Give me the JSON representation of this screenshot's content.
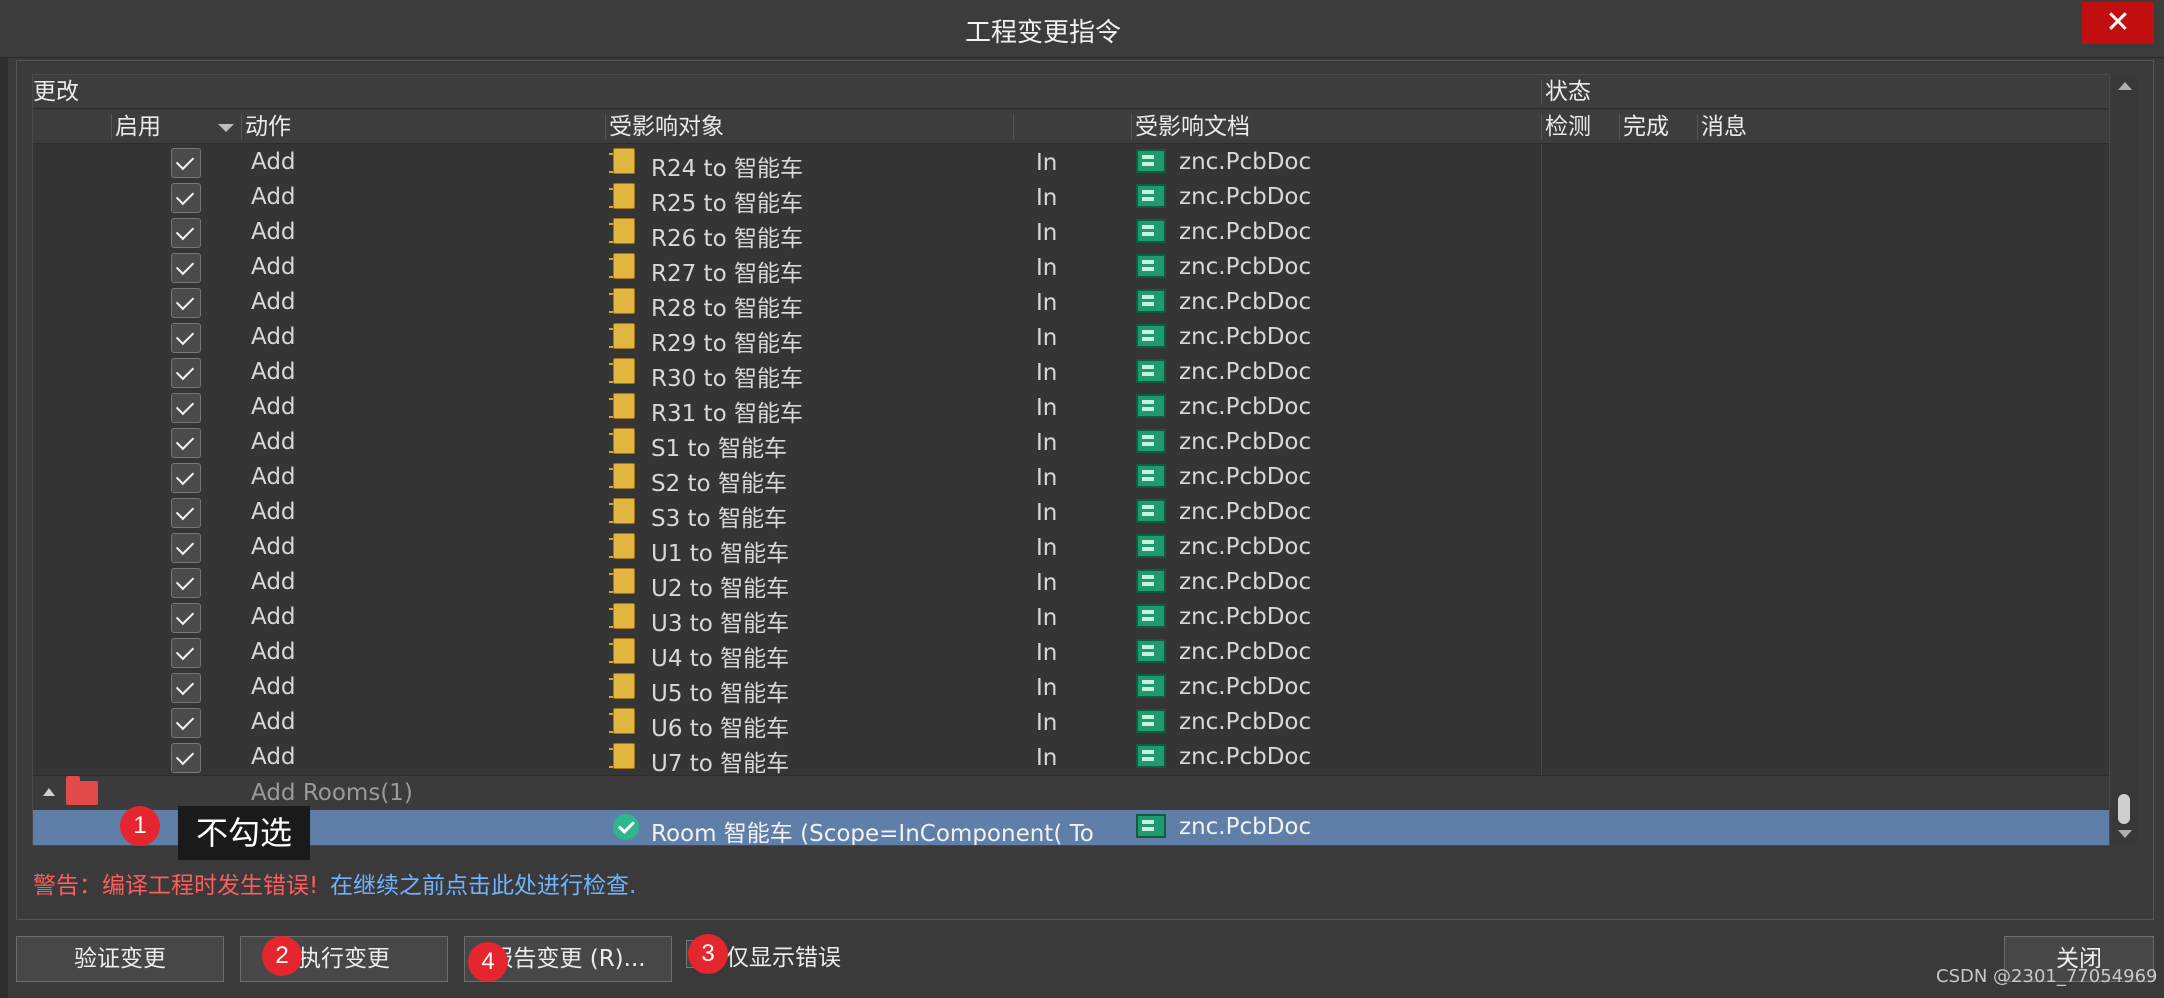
{
  "window": {
    "title": "工程变更指令",
    "close_glyph": "✕"
  },
  "table": {
    "group_headers": {
      "changes": "更改",
      "status": "状态"
    },
    "columns": {
      "enable": "启用",
      "action": "动作",
      "affected_object": "受影响对象",
      "affected_document": "受影响文档",
      "check": "检测",
      "done": "完成",
      "message": "消息"
    },
    "rows": [
      {
        "action": "Add",
        "object": "R24 to 智能车",
        "in": "In",
        "document": "znc.PcbDoc"
      },
      {
        "action": "Add",
        "object": "R25 to 智能车",
        "in": "In",
        "document": "znc.PcbDoc"
      },
      {
        "action": "Add",
        "object": "R26 to 智能车",
        "in": "In",
        "document": "znc.PcbDoc"
      },
      {
        "action": "Add",
        "object": "R27 to 智能车",
        "in": "In",
        "document": "znc.PcbDoc"
      },
      {
        "action": "Add",
        "object": "R28 to 智能车",
        "in": "In",
        "document": "znc.PcbDoc"
      },
      {
        "action": "Add",
        "object": "R29 to 智能车",
        "in": "In",
        "document": "znc.PcbDoc"
      },
      {
        "action": "Add",
        "object": "R30 to 智能车",
        "in": "In",
        "document": "znc.PcbDoc"
      },
      {
        "action": "Add",
        "object": "R31 to 智能车",
        "in": "In",
        "document": "znc.PcbDoc"
      },
      {
        "action": "Add",
        "object": "S1 to 智能车",
        "in": "In",
        "document": "znc.PcbDoc"
      },
      {
        "action": "Add",
        "object": "S2 to 智能车",
        "in": "In",
        "document": "znc.PcbDoc"
      },
      {
        "action": "Add",
        "object": "S3 to 智能车",
        "in": "In",
        "document": "znc.PcbDoc"
      },
      {
        "action": "Add",
        "object": "U1 to 智能车",
        "in": "In",
        "document": "znc.PcbDoc"
      },
      {
        "action": "Add",
        "object": "U2 to 智能车",
        "in": "In",
        "document": "znc.PcbDoc"
      },
      {
        "action": "Add",
        "object": "U3 to 智能车",
        "in": "In",
        "document": "znc.PcbDoc"
      },
      {
        "action": "Add",
        "object": "U4 to 智能车",
        "in": "In",
        "document": "znc.PcbDoc"
      },
      {
        "action": "Add",
        "object": "U5 to 智能车",
        "in": "In",
        "document": "znc.PcbDoc"
      },
      {
        "action": "Add",
        "object": "U6 to 智能车",
        "in": "In",
        "document": "znc.PcbDoc"
      },
      {
        "action": "Add",
        "object": "U7 to 智能车",
        "in": "In",
        "document": "znc.PcbDoc"
      }
    ],
    "group": {
      "label": "Add Rooms(1)"
    },
    "selected_row": {
      "object": "Room 智能车 (Scope=InComponent( To",
      "document": "znc.PcbDoc"
    }
  },
  "annotations": {
    "badge1": "1",
    "badge2": "2",
    "badge3": "3",
    "badge4": "4",
    "tooltip": "不勾选",
    "badge_color": "#e6262e"
  },
  "warning": {
    "text": "警告：编译工程时发生错误!",
    "link": "在继续之前点击此处进行检查."
  },
  "buttons": {
    "validate": "验证变更",
    "execute": "执行变更",
    "report": "报告变更 (R)...",
    "only_errors": "仅显示错误",
    "close": "关闭"
  },
  "watermark": "CSDN @2301_77054969"
}
